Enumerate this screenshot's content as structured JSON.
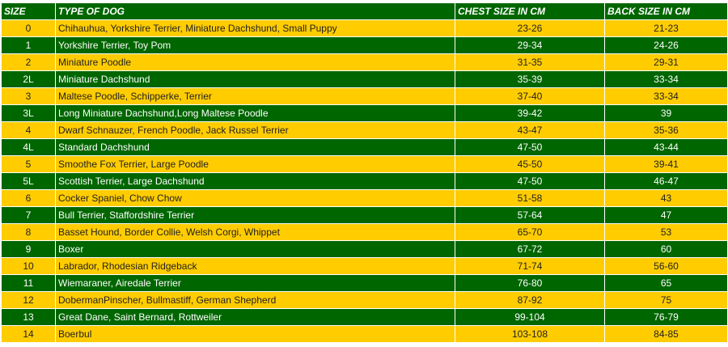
{
  "colors": {
    "header_bg": "#006600",
    "green_row": "#006600",
    "yellow_row": "#ffcc00"
  },
  "headers": {
    "size": "SIZE",
    "dog": "TYPE OF DOG",
    "chest": "CHEST SIZE IN CM",
    "back": "BACK SIZE IN CM"
  },
  "rows": [
    {
      "size": "0",
      "dog": "Chihauhua, Yorkshire Terrier, Miniature Dachshund, Small Puppy",
      "chest": "23-26",
      "back": "21-23"
    },
    {
      "size": "1",
      "dog": "Yorkshire Terrier, Toy Pom",
      "chest": "29-34",
      "back": "24-26"
    },
    {
      "size": "2",
      "dog": "Miniature Poodle",
      "chest": "31-35",
      "back": "29-31"
    },
    {
      "size": "2L",
      "dog": "Miniature Dachshund",
      "chest": "35-39",
      "back": "33-34"
    },
    {
      "size": "3",
      "dog": "Maltese Poodle, Schipperke, Terrier",
      "chest": "37-40",
      "back": "33-34"
    },
    {
      "size": "3L",
      "dog": "Long Miniature Dachshund,Long Maltese Poodle",
      "chest": "39-42",
      "back": "39"
    },
    {
      "size": "4",
      "dog": "Dwarf Schnauzer, French Poodle, Jack Russel Terrier",
      "chest": "43-47",
      "back": "35-36"
    },
    {
      "size": "4L",
      "dog": "Standard Dachshund",
      "chest": "47-50",
      "back": "43-44"
    },
    {
      "size": "5",
      "dog": "Smoothe Fox Terrier, Large Poodle",
      "chest": "45-50",
      "back": "39-41"
    },
    {
      "size": "5L",
      "dog": "Scottish Terrier, Large Dachshund",
      "chest": "47-50",
      "back": "46-47"
    },
    {
      "size": "6",
      "dog": "Cocker Spaniel, Chow Chow",
      "chest": "51-58",
      "back": "43"
    },
    {
      "size": "7",
      "dog": "Bull Terrier, Staffordshire Terrier",
      "chest": "57-64",
      "back": "47"
    },
    {
      "size": "8",
      "dog": "Basset Hound, Border Collie, Welsh Corgi, Whippet",
      "chest": "65-70",
      "back": "53"
    },
    {
      "size": "9",
      "dog": "Boxer",
      "chest": "67-72",
      "back": "60"
    },
    {
      "size": "10",
      "dog": "Labrador, Rhodesian Ridgeback",
      "chest": "71-74",
      "back": "56-60"
    },
    {
      "size": "11",
      "dog": "Wiemaraner, Airedale Terrier",
      "chest": "76-80",
      "back": "65"
    },
    {
      "size": "12",
      "dog": "DobermanPinscher, Bullmastiff, German Shepherd",
      "chest": "87-92",
      "back": "75"
    },
    {
      "size": "13",
      "dog": "Great Dane, Saint Bernard, Rottweiler",
      "chest": "99-104",
      "back": "76-79"
    },
    {
      "size": "14",
      "dog": "Boerbul",
      "chest": "103-108",
      "back": "84-85"
    }
  ]
}
